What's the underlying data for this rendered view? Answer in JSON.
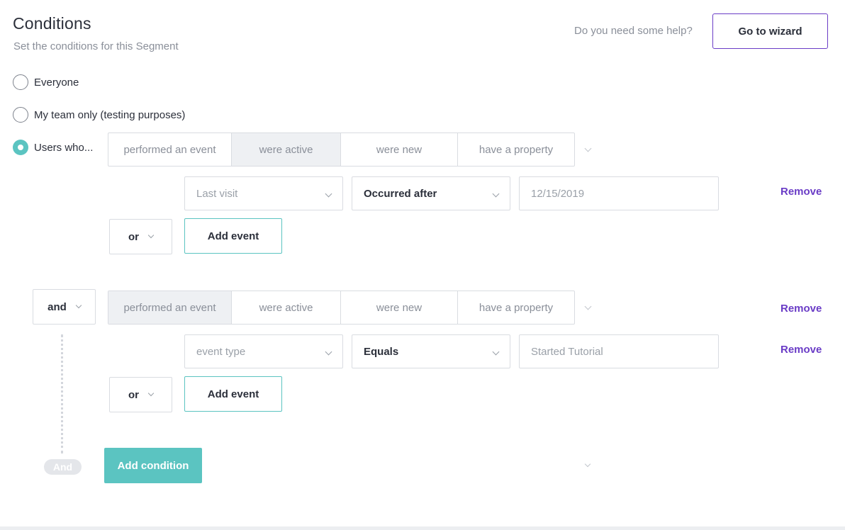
{
  "header": {
    "title": "Conditions",
    "subtitle": "Set the conditions for this Segment",
    "help_text": "Do you need some help?",
    "wizard_button": "Go to wizard"
  },
  "audience": {
    "options": [
      "Everyone",
      "My team only (testing purposes)",
      "Users who..."
    ],
    "selected": "Users who..."
  },
  "segment_tabs": [
    "performed an event",
    "were active",
    "were new",
    "have a property"
  ],
  "condition_1": {
    "active_tab": "were active",
    "rule": {
      "field": "Last visit",
      "operator": "Occurred after",
      "value_placeholder": "12/15/2019"
    },
    "logic": "or",
    "add_event": "Add event",
    "remove": "Remove"
  },
  "condition_2": {
    "joiner": "and",
    "active_tab": "performed an event",
    "remove": "Remove",
    "rule": {
      "field": "event type",
      "operator": "Equals",
      "value_placeholder": "Started Tutorial"
    },
    "rule_remove": "Remove",
    "logic": "or",
    "add_event": "Add event"
  },
  "footer": {
    "and_pill": "And",
    "add_condition": "Add condition"
  },
  "colors": {
    "accent_teal": "#5bc4c1",
    "accent_purple": "#6a3cc6",
    "border": "#d9dce1"
  }
}
